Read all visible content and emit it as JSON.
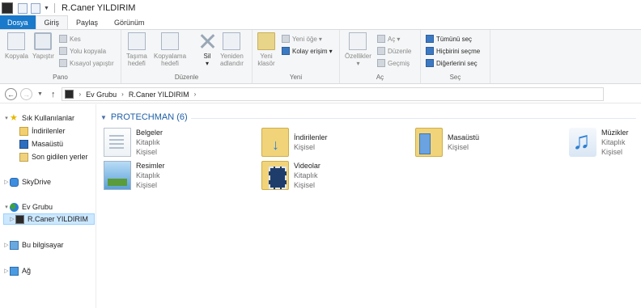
{
  "window": {
    "title": "R.Caner YILDIRIM"
  },
  "ribbon_tabs": [
    {
      "label": "Dosya"
    },
    {
      "label": "Giriş"
    },
    {
      "label": "Paylaş"
    },
    {
      "label": "Görünüm"
    }
  ],
  "ribbon": {
    "pano": {
      "label": "Pano",
      "copy": "Kopyala",
      "paste": "Yapıştır",
      "cut": "Kes",
      "copy_path": "Yolu kopyala",
      "paste_shortcut": "Kısayol yapıştır"
    },
    "duzenle": {
      "label": "Düzenle",
      "move_to_1": "Taşıma",
      "move_to_2": "hedefi",
      "copy_to_1": "Kopyalama",
      "copy_to_2": "hedefi",
      "delete": "Sil",
      "rename_1": "Yeniden",
      "rename_2": "adlandır"
    },
    "yeni": {
      "label": "Yeni",
      "new_folder_1": "Yeni",
      "new_folder_2": "klasör",
      "new_item": "Yeni öğe",
      "easy_access": "Kolay erişim"
    },
    "ac": {
      "label": "Aç",
      "properties": "Özellikler",
      "open": "Aç",
      "edit": "Düzenle",
      "history": "Geçmiş"
    },
    "sec": {
      "label": "Seç",
      "select_all": "Tümünü seç",
      "select_none": "Hiçbirini seçme",
      "invert": "Diğerlerini seç"
    }
  },
  "address": {
    "crumbs": [
      "Ev Grubu",
      "R.Caner YILDIRIM"
    ]
  },
  "nav_pane": {
    "favorites": "Sık Kullanılanlar",
    "downloads": "İndirilenler",
    "desktop": "Masaüstü",
    "recent": "Son gidilen yerler",
    "skydrive": "SkyDrive",
    "homegroup": "Ev Grubu",
    "user": "R.Caner YILDIRIM",
    "computer": "Bu bilgisayar",
    "network": "Ağ"
  },
  "content": {
    "group_title": "PROTECHMAN (6)",
    "libraries": [
      {
        "name": "Belgeler",
        "line1": "Kitaplık",
        "line2": "Kişisel",
        "icon": "documents-library-icon"
      },
      {
        "name": "İndirilenler",
        "line1": "Kişisel",
        "line2": "",
        "icon": "downloads-folder-icon"
      },
      {
        "name": "Masaüstü",
        "line1": "Kişisel",
        "line2": "",
        "icon": "desktop-folder-icon"
      },
      {
        "name": "Müzikler",
        "line1": "Kitaplık",
        "line2": "Kişisel",
        "icon": "music-library-icon"
      },
      {
        "name": "Resimler",
        "line1": "Kitaplık",
        "line2": "Kişisel",
        "icon": "pictures-library-icon"
      },
      {
        "name": "Videolar",
        "line1": "Kitaplık",
        "line2": "Kişisel",
        "icon": "videos-library-icon"
      }
    ]
  },
  "colors": {
    "file_tab": "#1979ca",
    "group_header": "#1e5fa8",
    "selection": "#cce8ff"
  }
}
